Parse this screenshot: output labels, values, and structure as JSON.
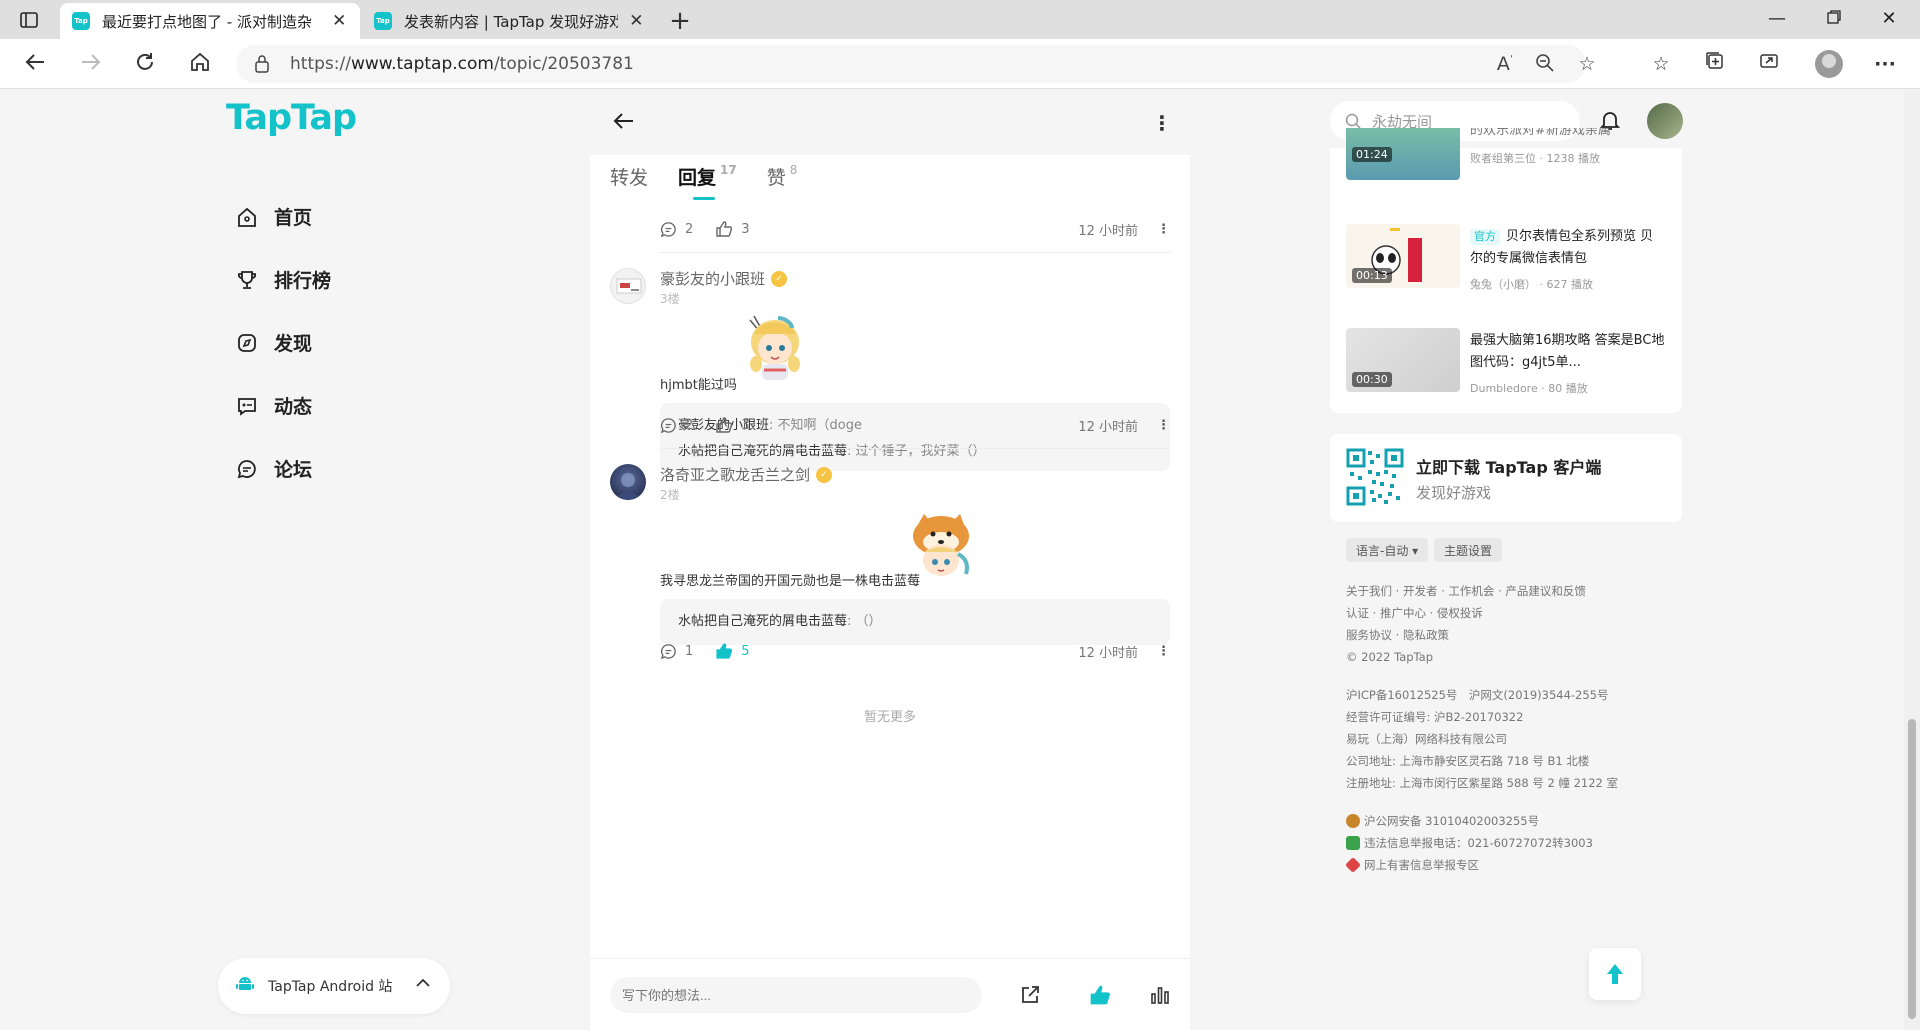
{
  "browser": {
    "tabs": [
      {
        "title": "最近要打点地图了 - 派对制造杂",
        "favicon": "Tap",
        "active": true
      },
      {
        "title": "发表新内容 | TapTap 发现好游戏",
        "favicon": "Tap",
        "active": false
      }
    ],
    "url_prefix": "https://",
    "url_host": "www.taptap.com",
    "url_path": "/topic/20503781"
  },
  "site": {
    "logo": "TapTap",
    "nav": [
      {
        "label": "首页",
        "icon": "home-icon"
      },
      {
        "label": "排行榜",
        "icon": "trophy-icon"
      },
      {
        "label": "发现",
        "icon": "discover-icon"
      },
      {
        "label": "动态",
        "icon": "feed-icon"
      },
      {
        "label": "论坛",
        "icon": "forum-icon"
      }
    ],
    "android_pill": "TapTap Android 站"
  },
  "topic": {
    "tabs": [
      {
        "label": "转发",
        "count": ""
      },
      {
        "label": "回复",
        "count": "17"
      },
      {
        "label": "赞",
        "count": "8"
      }
    ],
    "first_actions": {
      "comments": "2",
      "likes": "3",
      "time": "12 小时前"
    },
    "replies": [
      {
        "author": "豪彭友的小跟班",
        "floor": "3楼",
        "text": "hjmbt能过吗",
        "subreplies": [
          {
            "author": "豪彭友的小跟班",
            "text": "不知啊（doge"
          },
          {
            "author": "水帖把自己淹死的屑电击蓝莓",
            "text": "过个锤子，我好菜（）"
          }
        ],
        "comments": "2",
        "likes": "3",
        "time": "12 小时前"
      },
      {
        "author": "洛奇亚之歌龙舌兰之剑",
        "floor": "2楼",
        "text": "我寻思龙兰帝国的开国元勋也是一株电击蓝莓",
        "subreplies": [
          {
            "author": "水帖把自己淹死的屑电击蓝莓",
            "text": "（）"
          }
        ],
        "comments": "1",
        "likes": "5",
        "time": "12 小时前"
      }
    ],
    "no_more": "暂无更多",
    "comment_placeholder": "写下你的想法..."
  },
  "right": {
    "search_placeholder": "永劫无间",
    "videos": [
      {
        "title_partial": "的欢乐派对#新游戏亲属",
        "meta": "败者组第三位 · 1238 播放",
        "duration": "01:24",
        "official": ""
      },
      {
        "title": "贝尔表情包全系列预览 贝尔的专属微信表情包",
        "meta": "兔兔（小磨） · 627 播放",
        "duration": "00:13",
        "official": "官方"
      },
      {
        "title": "最强大脑第16期攻略 答案是BC地图代码：g4jt5单...",
        "meta": "Dumbledore · 80 播放",
        "duration": "00:30",
        "official": ""
      }
    ],
    "download": {
      "title": "立即下载 TapTap 客户端",
      "subtitle": "发现好游戏"
    },
    "language_btn": "语言-自动 ▾",
    "theme_btn": "主题设置",
    "footer_lines": [
      "关于我们 · 开发者 · 工作机会 · 产品建议和反馈",
      "认证 · 推广中心 · 侵权投诉",
      "服务协议 · 隐私政策",
      "© 2022 TapTap"
    ],
    "legal_lines": [
      "沪ICP备16012525号　沪网文(2019)3544-255号",
      "经营许可证编号: 沪B2-20170322",
      "易玩（上海）网络科技有限公司",
      "公司地址: 上海市静安区灵石路 718 号 B1 北楼",
      "注册地址: 上海市闵行区紫星路 588 号 2 幢 2122 室"
    ],
    "beian_lines": [
      "沪公网安备 31010402003255号",
      "违法信息举报电话：021-60727072转3003",
      "网上有害信息举报专区"
    ]
  },
  "colors": {
    "brand": "#14c3c9",
    "badge": "#f6c343"
  }
}
